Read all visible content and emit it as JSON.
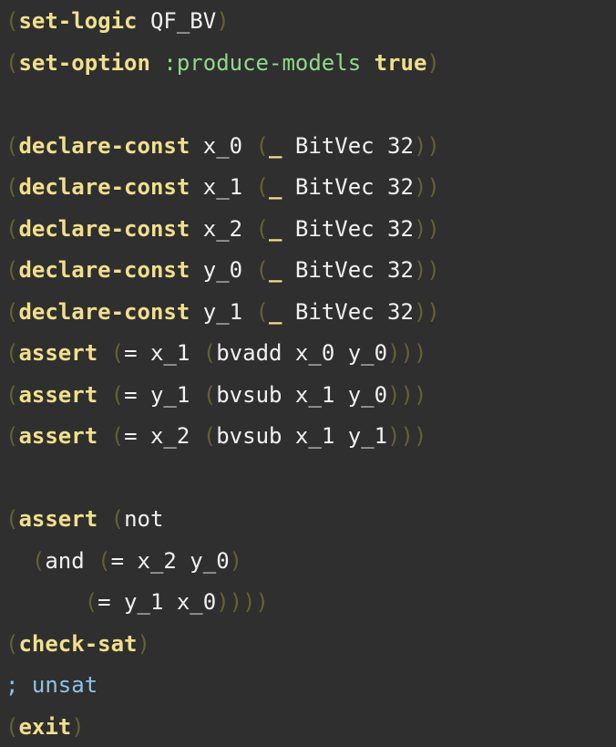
{
  "lines": [
    {
      "row": 0,
      "tokens": [
        [
          "p",
          "("
        ],
        [
          "k",
          "set-logic"
        ],
        [
          "n",
          " QF_BV"
        ],
        [
          "p",
          ")"
        ]
      ]
    },
    {
      "row": 1,
      "tokens": [
        [
          "p",
          "("
        ],
        [
          "k",
          "set-option"
        ],
        [
          "n",
          " "
        ],
        [
          "o",
          ":produce-models"
        ],
        [
          "n",
          " "
        ],
        [
          "t",
          "true"
        ],
        [
          "p",
          ")"
        ]
      ]
    },
    {
      "row": 3,
      "tokens": [
        [
          "p",
          "("
        ],
        [
          "k",
          "declare-const"
        ],
        [
          "n",
          " x_0 "
        ],
        [
          "p",
          "("
        ],
        [
          "k",
          "_"
        ],
        [
          "n",
          " BitVec 32"
        ],
        [
          "p",
          "))"
        ]
      ]
    },
    {
      "row": 4,
      "tokens": [
        [
          "p",
          "("
        ],
        [
          "k",
          "declare-const"
        ],
        [
          "n",
          " x_1 "
        ],
        [
          "p",
          "("
        ],
        [
          "k",
          "_"
        ],
        [
          "n",
          " BitVec 32"
        ],
        [
          "p",
          "))"
        ]
      ]
    },
    {
      "row": 5,
      "tokens": [
        [
          "p",
          "("
        ],
        [
          "k",
          "declare-const"
        ],
        [
          "n",
          " x_2 "
        ],
        [
          "p",
          "("
        ],
        [
          "k",
          "_"
        ],
        [
          "n",
          " BitVec 32"
        ],
        [
          "p",
          "))"
        ]
      ]
    },
    {
      "row": 6,
      "tokens": [
        [
          "p",
          "("
        ],
        [
          "k",
          "declare-const"
        ],
        [
          "n",
          " y_0 "
        ],
        [
          "p",
          "("
        ],
        [
          "k",
          "_"
        ],
        [
          "n",
          " BitVec 32"
        ],
        [
          "p",
          "))"
        ]
      ]
    },
    {
      "row": 7,
      "tokens": [
        [
          "p",
          "("
        ],
        [
          "k",
          "declare-const"
        ],
        [
          "n",
          " y_1 "
        ],
        [
          "p",
          "("
        ],
        [
          "k",
          "_"
        ],
        [
          "n",
          " BitVec 32"
        ],
        [
          "p",
          "))"
        ]
      ]
    },
    {
      "row": 8,
      "tokens": [
        [
          "p",
          "("
        ],
        [
          "k",
          "assert"
        ],
        [
          "n",
          " "
        ],
        [
          "p",
          "("
        ],
        [
          "n",
          "= x_1 "
        ],
        [
          "p",
          "("
        ],
        [
          "n",
          "bvadd x_0 y_0"
        ],
        [
          "p",
          ")))"
        ]
      ]
    },
    {
      "row": 9,
      "tokens": [
        [
          "p",
          "("
        ],
        [
          "k",
          "assert"
        ],
        [
          "n",
          " "
        ],
        [
          "p",
          "("
        ],
        [
          "n",
          "= y_1 "
        ],
        [
          "p",
          "("
        ],
        [
          "n",
          "bvsub x_1 y_0"
        ],
        [
          "p",
          ")))"
        ]
      ]
    },
    {
      "row": 10,
      "tokens": [
        [
          "p",
          "("
        ],
        [
          "k",
          "assert"
        ],
        [
          "n",
          " "
        ],
        [
          "p",
          "("
        ],
        [
          "n",
          "= x_2 "
        ],
        [
          "p",
          "("
        ],
        [
          "n",
          "bvsub x_1 y_1"
        ],
        [
          "p",
          ")))"
        ]
      ]
    },
    {
      "row": 12,
      "tokens": [
        [
          "p",
          "("
        ],
        [
          "k",
          "assert"
        ],
        [
          "n",
          " "
        ],
        [
          "p",
          "("
        ],
        [
          "n",
          "not"
        ]
      ]
    },
    {
      "row": 13,
      "tokens": [
        [
          "n",
          "  "
        ],
        [
          "p",
          "("
        ],
        [
          "n",
          "and "
        ],
        [
          "p",
          "("
        ],
        [
          "n",
          "= x_2 y_0"
        ],
        [
          "p",
          ")"
        ]
      ]
    },
    {
      "row": 14,
      "tokens": [
        [
          "n",
          "      "
        ],
        [
          "p",
          "("
        ],
        [
          "n",
          "= y_1 x_0"
        ],
        [
          "p",
          "))))"
        ]
      ]
    },
    {
      "row": 15,
      "tokens": [
        [
          "p",
          "("
        ],
        [
          "k",
          "check-sat"
        ],
        [
          "p",
          ")"
        ]
      ]
    },
    {
      "row": 16,
      "tokens": [
        [
          "c",
          "; unsat"
        ]
      ]
    },
    {
      "row": 17,
      "tokens": [
        [
          "p",
          "("
        ],
        [
          "k",
          "exit"
        ],
        [
          "p",
          ")"
        ]
      ]
    }
  ]
}
